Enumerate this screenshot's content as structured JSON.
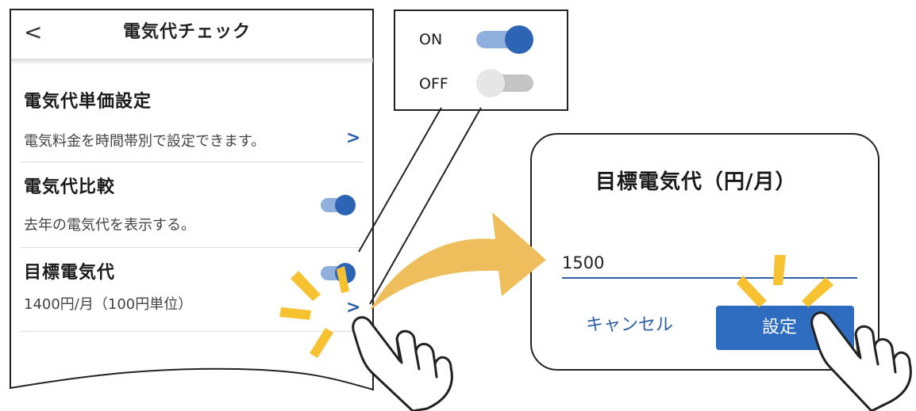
{
  "header": {
    "back_glyph": "<",
    "title": "電気代チェック"
  },
  "settings": [
    {
      "title": "電気代単価設定",
      "subtitle": "電気料金を時間帯別で設定できます。",
      "chevron": ">"
    },
    {
      "title": "電気代比較",
      "subtitle": "去年の電気代を表示する。",
      "toggle": "on"
    },
    {
      "title": "目標電気代",
      "subtitle": "1400円/月（100円単位）",
      "toggle": "on",
      "chevron": ">"
    }
  ],
  "legend": {
    "on_label": "ON",
    "off_label": "OFF"
  },
  "dialog": {
    "title": "目標電気代（円/月）",
    "input_value": "1500",
    "cancel_label": "キャンセル",
    "confirm_label": "設定"
  },
  "colors": {
    "accent": "#2e6cc0",
    "toggle_on_track": "#8fb0dd",
    "toggle_on_knob": "#2e64b4",
    "toggle_off_track": "#c4c4c4",
    "toggle_off_knob": "#e6e6e6",
    "arrow": "#efbe5c",
    "highlight": "#f7c232"
  },
  "icons": {
    "back": "chevron-left-icon",
    "row_chevron": "chevron-right-icon",
    "tap_hand": "pointing-hand-icon",
    "tap_burst": "tap-burst-icon",
    "flow_arrow": "curved-arrow-icon"
  }
}
